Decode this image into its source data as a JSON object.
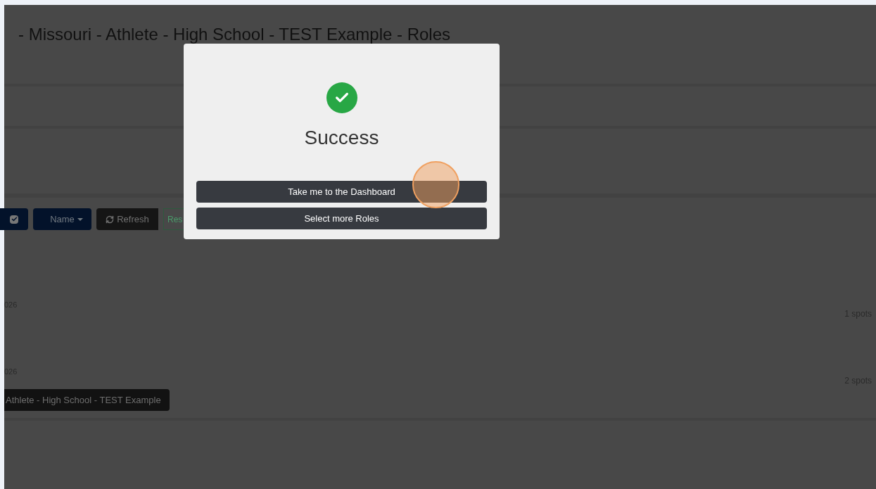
{
  "page": {
    "title": "- Missouri - Athlete - High School - TEST Example - Roles"
  },
  "toolbar": [
    {
      "kind": "checkbox",
      "checked": true
    },
    {
      "kind": "dropdown",
      "label": "Name"
    },
    {
      "kind": "refresh",
      "label": "Refresh"
    },
    {
      "kind": "outline",
      "label": "Res"
    }
  ],
  "rows": [
    {
      "date": "026",
      "spots": "1 spots"
    },
    {
      "date": "026",
      "spots": "2 spots"
    }
  ],
  "footer_button": "Athlete - High School - TEST Example",
  "modal": {
    "title": "Success",
    "buttons": [
      "Take me to the Dashboard",
      "Select more Roles"
    ]
  }
}
